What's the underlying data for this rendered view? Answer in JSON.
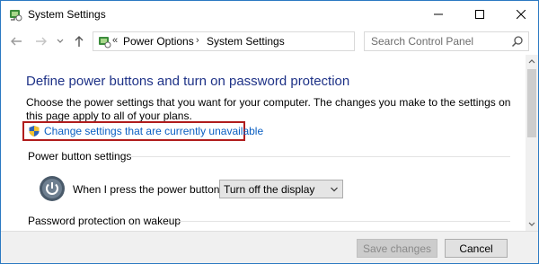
{
  "window": {
    "title": "System Settings",
    "icon": "power-options-icon"
  },
  "nav": {
    "address_separator_start": "«",
    "breadcrumb": [
      {
        "label": "Power Options"
      },
      {
        "label": "System Settings"
      }
    ],
    "breadcrumb_separator": "›",
    "search_placeholder": "Search Control Panel"
  },
  "content": {
    "title": "Define power buttons and turn on password protection",
    "description": "Choose the power settings that you want for your computer. The changes you make to the settings on this page apply to all of your plans.",
    "change_link": "Change settings that are currently unavailable",
    "power_section_heading": "Power button settings",
    "power_button_label": "When I press the power button:",
    "power_button_value": "Turn off the display",
    "password_section_heading": "Password protection on wakeup"
  },
  "footer": {
    "save_label": "Save changes",
    "cancel_label": "Cancel"
  },
  "colors": {
    "title_blue": "#1e3287",
    "link_blue": "#0a5fc2",
    "highlight_red": "#b01c1c"
  }
}
